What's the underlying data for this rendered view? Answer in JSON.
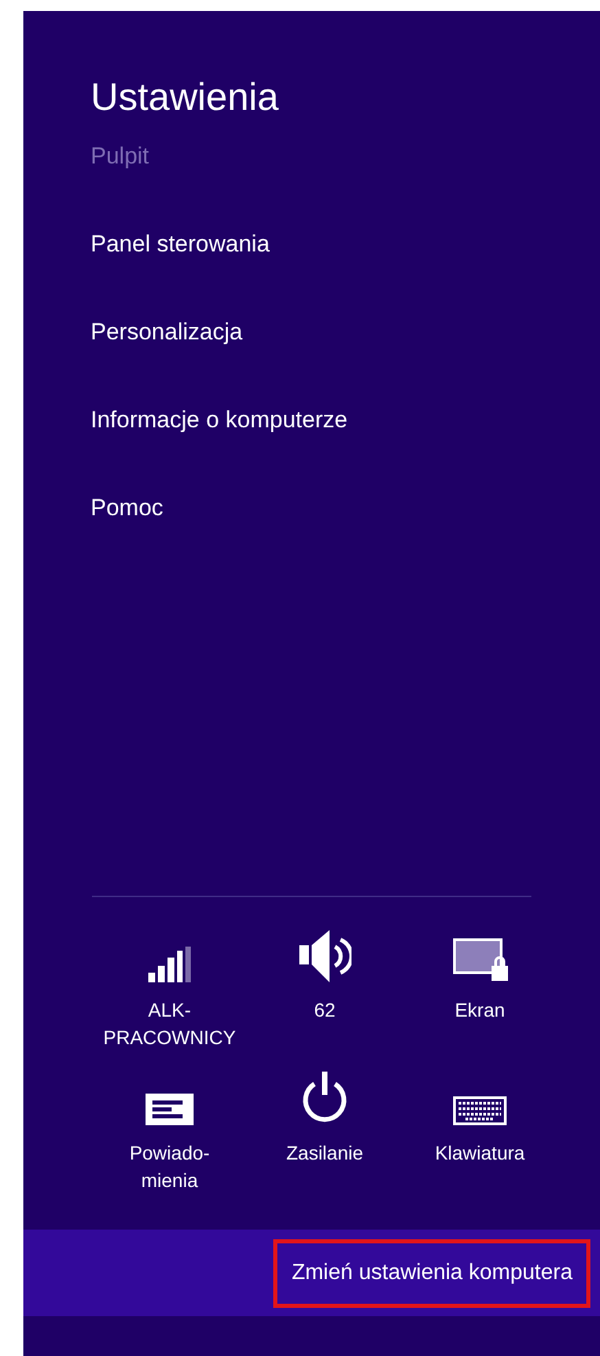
{
  "title": "Ustawienia",
  "menu": [
    {
      "label": "Pulpit",
      "disabled": true
    },
    {
      "label": "Panel sterowania",
      "disabled": false
    },
    {
      "label": "Personalizacja",
      "disabled": false
    },
    {
      "label": "Informacje o komputerze",
      "disabled": false
    },
    {
      "label": "Pomoc",
      "disabled": false
    }
  ],
  "quick_settings": [
    {
      "kind": "network",
      "label": "ALK-\nPRACOWNICY"
    },
    {
      "kind": "volume",
      "label": "62"
    },
    {
      "kind": "screen",
      "label": "Ekran"
    },
    {
      "kind": "notifications",
      "label": "Powiado-\nmienia"
    },
    {
      "kind": "power",
      "label": "Zasilanie"
    },
    {
      "kind": "keyboard",
      "label": "Klawiatura"
    }
  ],
  "footer_link": {
    "label": "Zmień ustawienia komputera",
    "highlighted": true
  }
}
